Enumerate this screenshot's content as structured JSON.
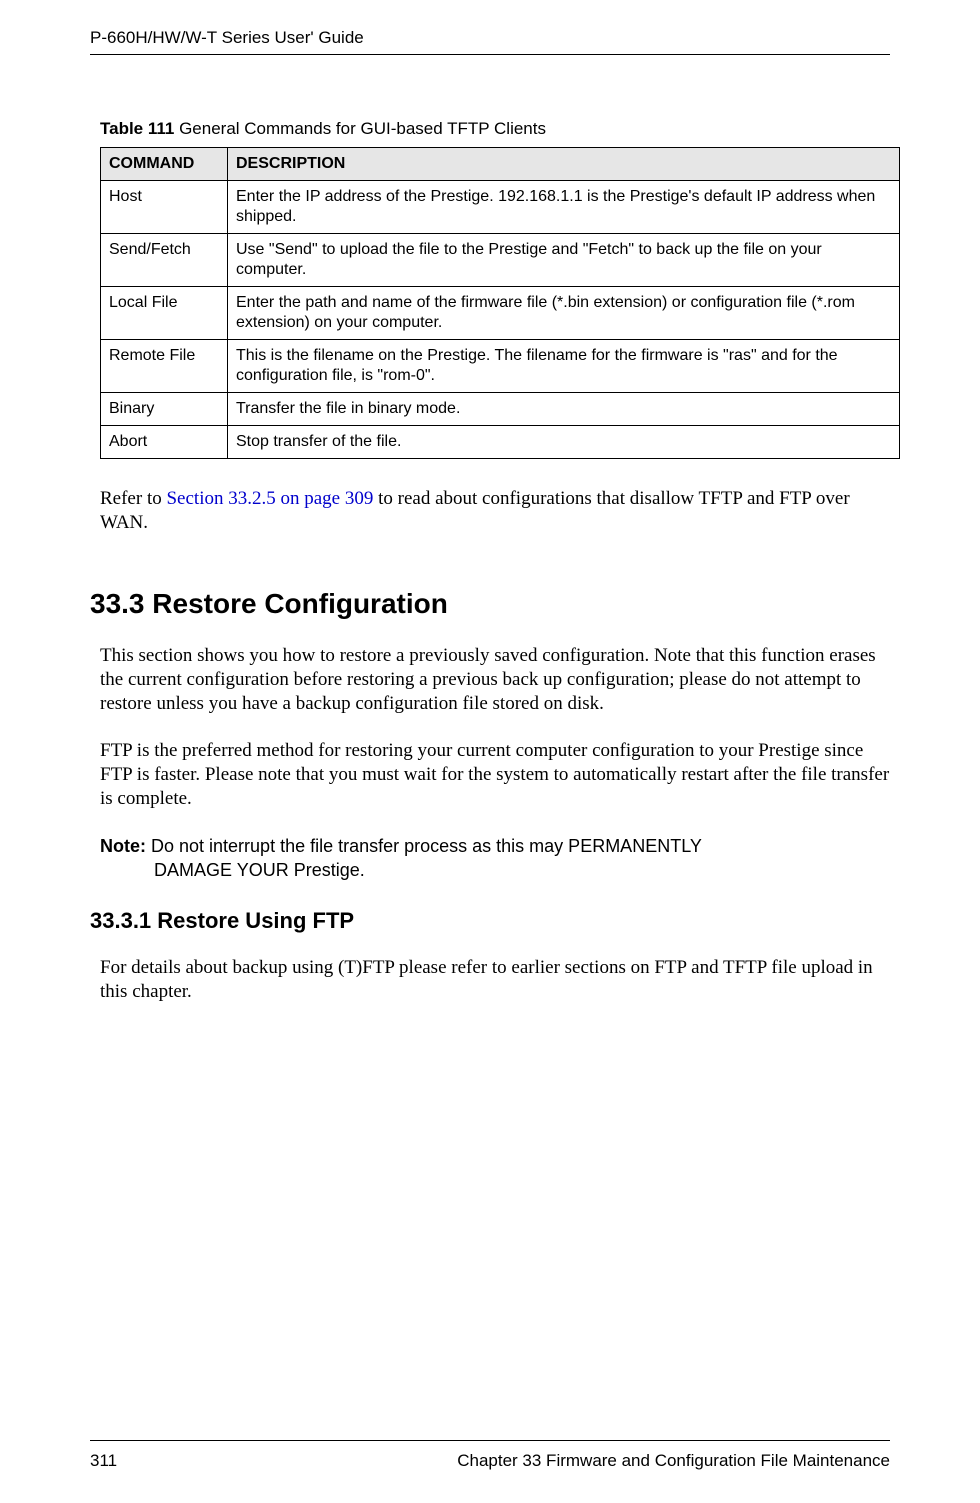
{
  "header": {
    "guide_title": "P-660H/HW/W-T Series User' Guide"
  },
  "table": {
    "caption_bold": "Table 111",
    "caption_rest": "   General Commands for GUI-based TFTP Clients",
    "headers": {
      "command": "COMMAND",
      "description": "DESCRIPTION"
    },
    "rows": [
      {
        "command": "Host",
        "description": "Enter the IP address of the Prestige. 192.168.1.1 is the Prestige's default IP address when shipped."
      },
      {
        "command": "Send/Fetch",
        "description": "Use \"Send\" to upload the file to the Prestige and \"Fetch\" to back up the file on your computer."
      },
      {
        "command": "Local File",
        "description": "Enter the path and name of the firmware file (*.bin extension) or configuration file (*.rom extension) on your computer."
      },
      {
        "command": "Remote File",
        "description": "This is the filename on the Prestige. The filename for the firmware is \"ras\" and for the configuration file, is \"rom-0\"."
      },
      {
        "command": "Binary",
        "description": "Transfer the file in binary mode."
      },
      {
        "command": "Abort",
        "description": "Stop transfer of the file."
      }
    ]
  },
  "refer_para": {
    "pre": "Refer to ",
    "xref": "Section 33.2.5 on page 309",
    "post": " to read about configurations that disallow TFTP and FTP over WAN."
  },
  "section_33_3": {
    "heading": "33.3  Restore Configuration",
    "p1": "This section shows you how to restore a previously saved configuration. Note that this function erases the current configuration before restoring a previous back up configuration; please do not attempt to restore unless you have a backup configuration file stored on disk.",
    "p2": "FTP is the preferred method for restoring your current computer configuration to your Prestige since FTP is faster. Please note that you must wait for the system to automatically restart after the file transfer is complete.",
    "note_label": "Note: ",
    "note_line1": "Do not interrupt the file transfer process as this may PERMANENTLY",
    "note_line2": "DAMAGE YOUR Prestige."
  },
  "section_33_3_1": {
    "heading": "33.3.1  Restore Using FTP",
    "p1": "For details about backup using (T)FTP please refer to earlier sections on FTP and TFTP file upload in this chapter."
  },
  "footer": {
    "page_number": "311",
    "chapter": "Chapter 33 Firmware and Configuration File Maintenance"
  }
}
